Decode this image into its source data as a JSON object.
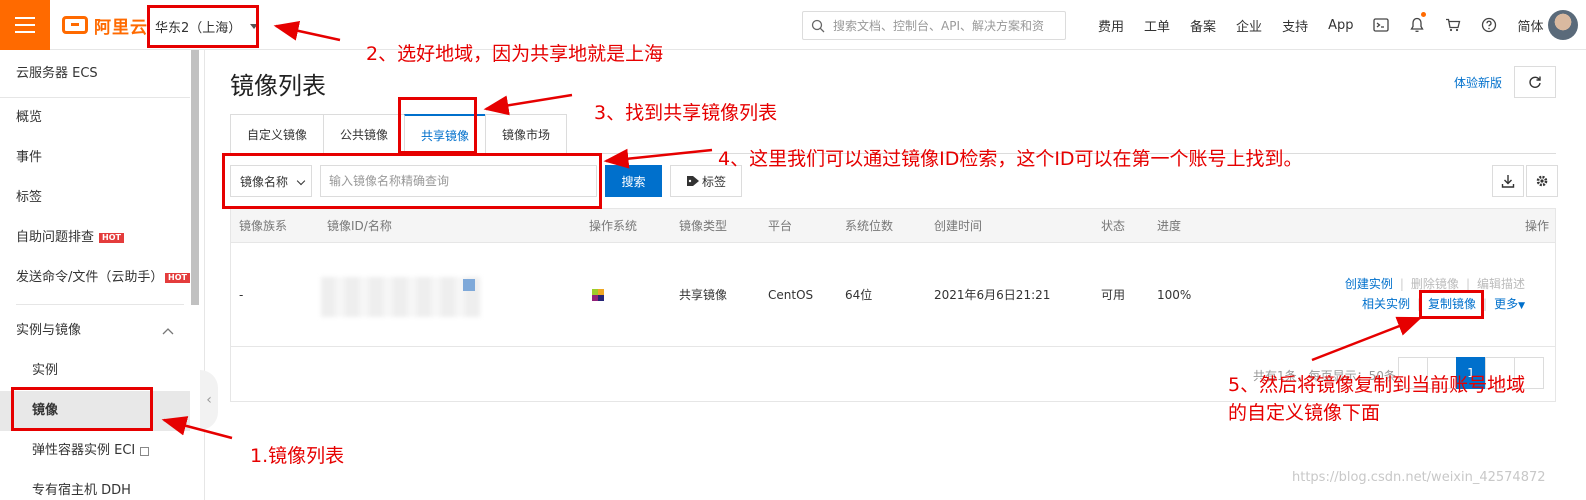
{
  "topbar": {
    "logo_text": "阿里云",
    "region": "华东2（上海）",
    "search_placeholder": "搜索文档、控制台、API、解决方案和资",
    "nav": [
      "费用",
      "工单",
      "备案",
      "企业",
      "支持",
      "App"
    ],
    "lang": "简体"
  },
  "sidebar": {
    "title": "云服务器 ECS",
    "items": [
      {
        "label": "概览"
      },
      {
        "label": "事件"
      },
      {
        "label": "标签"
      },
      {
        "label": "自助问题排查",
        "hot": "HOT"
      },
      {
        "label": "发送命令/文件（云助手）",
        "hot": "HOT"
      }
    ],
    "group": "实例与镜像",
    "sub_items": [
      {
        "label": "实例"
      },
      {
        "label": "镜像"
      },
      {
        "label": "弹性容器实例 ECI"
      },
      {
        "label": "专有宿主机 DDH"
      }
    ]
  },
  "main": {
    "title": "镜像列表",
    "new_version": "体验新版",
    "tabs": [
      "自定义镜像",
      "公共镜像",
      "共享镜像",
      "镜像市场"
    ],
    "filter_select": "镜像名称",
    "query_placeholder": "输入镜像名称精确查询",
    "search_btn": "搜索",
    "tag_btn": "标签",
    "columns": [
      "镜像族系",
      "镜像ID/名称",
      "操作系统",
      "镜像类型",
      "平台",
      "系统位数",
      "创建时间",
      "状态",
      "进度",
      "操作"
    ],
    "row": {
      "family": "-",
      "type": "共享镜像",
      "platform": "CentOS",
      "bits": "64位",
      "created": "2021年6月6日21:21",
      "status": "可用",
      "progress": "100%",
      "actions": {
        "create": "创建实例",
        "delete": "删除镜像",
        "edit": "编辑描述",
        "related": "相关实例",
        "copy": "复制镜像",
        "more": "更多"
      }
    },
    "pager_text": "共有1条，每页显示：50条",
    "pager_current": "1"
  },
  "annotations": {
    "n1": "1.镜像列表",
    "n2": "2、选好地域，因为共享地就是上海",
    "n3": "3、找到共享镜像列表",
    "n4": "4、这里我们可以通过镜像ID检索，这个ID可以在第一个账号上找到。",
    "n5a": "5、然后将镜像复制到当前账号地域",
    "n5b": "的自定义镜像下面"
  },
  "watermark": "https://blog.csdn.net/weixin_42574872",
  "colors": {
    "brand": "#ff6a00",
    "link": "#0070cc",
    "annotation": "#e60000"
  }
}
